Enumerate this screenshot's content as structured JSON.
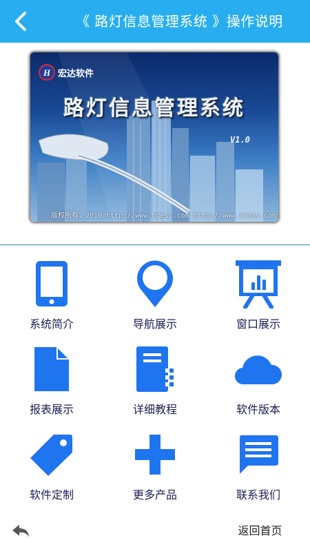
{
  "header": {
    "title": "《 路灯信息管理系统 》操作说明",
    "back_icon": "chevron-left-icon",
    "background": "#28aef0"
  },
  "banner": {
    "brand": "宏达软件",
    "title": "路灯信息管理系统",
    "version": "V1.0",
    "footer": "版权所有：2010 http://www.hdesc.com http://www.ixmis.com"
  },
  "menu": {
    "accent": "#1f74f0",
    "items": [
      {
        "label": "系统简介",
        "icon": "phone-icon"
      },
      {
        "label": "导航展示",
        "icon": "map-pin-icon"
      },
      {
        "label": "窗口展示",
        "icon": "presentation-icon"
      },
      {
        "label": "报表展示",
        "icon": "document-icon"
      },
      {
        "label": "详细教程",
        "icon": "notebook-icon"
      },
      {
        "label": "软件版本",
        "icon": "cloud-icon"
      },
      {
        "label": "软件定制",
        "icon": "tag-icon"
      },
      {
        "label": "更多产品",
        "icon": "plus-icon"
      },
      {
        "label": "联系我们",
        "icon": "message-icon"
      }
    ]
  },
  "footer": {
    "back_icon": "reply-arrow-icon",
    "home_label": "返回首页"
  }
}
